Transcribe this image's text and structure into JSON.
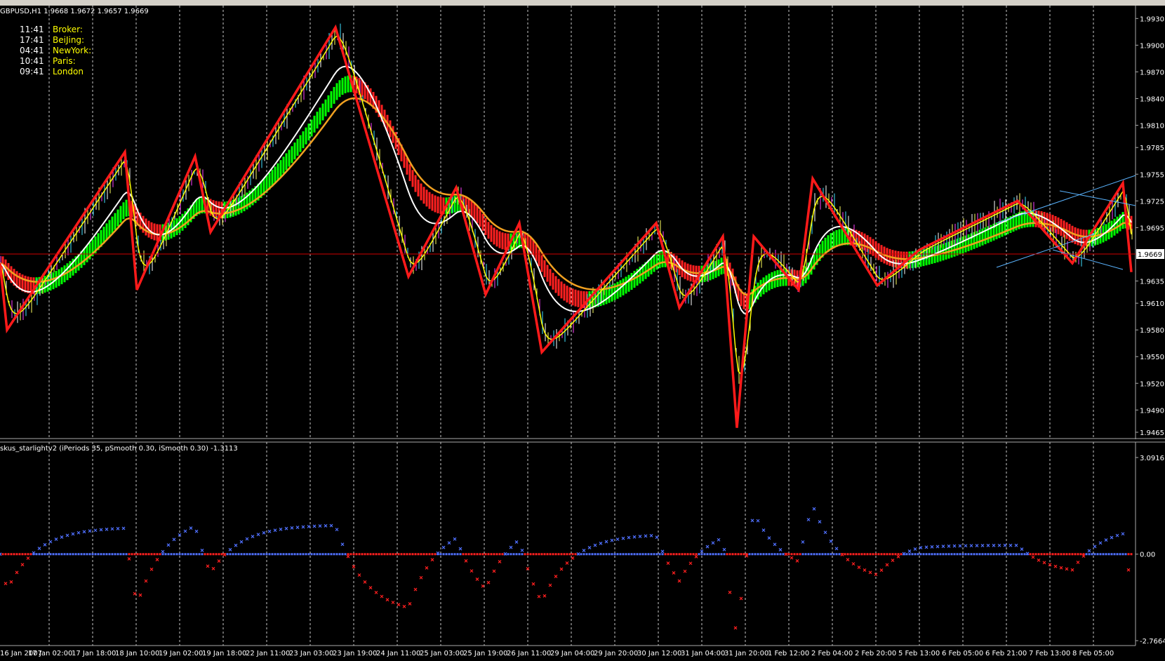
{
  "window": {
    "symbol_line": "GBPUSD,H1  1.9668 1.9672 1.9657 1.9669"
  },
  "clocks": [
    {
      "time": "11:41",
      "city": "Broker:"
    },
    {
      "time": "17:41",
      "city": "BeiJing:"
    },
    {
      "time": "04:41",
      "city": "NewYork:"
    },
    {
      "time": "10:41",
      "city": "Paris:"
    },
    {
      "time": "09:41",
      "city": "London"
    }
  ],
  "price_axis": {
    "ticks": [
      "1.9930",
      "1.9900",
      "1.9870",
      "1.9840",
      "1.9810",
      "1.9785",
      "1.9755",
      "1.9725",
      "1.9695",
      "1.9635",
      "1.9610",
      "1.9580",
      "1.9550",
      "1.9520",
      "1.9490",
      "1.9465"
    ],
    "current_price": "1.9669"
  },
  "indicator": {
    "label": "skus_starlightv2  (iPeriods 35, pSmooth 0.30, iSmooth 0.30)  -1.3113",
    "ticks": [
      "3.0916",
      "0.00",
      "-2.7664"
    ]
  },
  "time_axis": {
    "labels": [
      "16 Jan 2007",
      "17 Jan 02:00",
      "17 Jan 18:00",
      "18 Jan 10:00",
      "19 Jan 02:00",
      "19 Jan 18:00",
      "22 Jan 11:00",
      "23 Jan 03:00",
      "23 Jan 19:00",
      "24 Jan 11:00",
      "25 Jan 03:00",
      "25 Jan 19:00",
      "26 Jan 11:00",
      "29 Jan 04:00",
      "29 Jan 20:00",
      "30 Jan 12:00",
      "31 Jan 04:00",
      "31 Jan 20:00",
      "1 Feb 12:00",
      "2 Feb 04:00",
      "2 Feb 20:00",
      "5 Feb 13:00",
      "6 Feb 05:00",
      "6 Feb 21:00",
      "7 Feb 13:00",
      "8 Feb 05:00"
    ]
  },
  "colors": {
    "background": "#000000",
    "grid": "#c8c8c8",
    "zigzag": "#ff1a1a",
    "ribbon_up": "#00ff00",
    "ribbon_down": "#ff2020",
    "ma_white": "#ffffff",
    "ma_orange": "#f0a020",
    "ma_yellow": "#ffff00",
    "hist_positive": "#5070ff",
    "hist_negative": "#ff2020",
    "clock_time": "#ffffff",
    "clock_city": "#ffff00"
  },
  "chart_data": {
    "type": "line",
    "price_zigzag": [
      1.9655,
      1.958,
      1.978,
      1.9625,
      1.9775,
      1.969,
      1.992,
      1.964,
      1.974,
      1.962,
      1.97,
      1.9555,
      1.97,
      1.9605,
      1.9685,
      1.947,
      1.9685,
      1.9625,
      1.975,
      1.963,
      1.967,
      1.9725,
      1.9655,
      1.9745,
      1.9645
    ],
    "price_range": [
      1.9465,
      1.9935
    ],
    "indicator_range": [
      -2.7664,
      3.0916
    ],
    "indicator_last": -1.3113
  }
}
